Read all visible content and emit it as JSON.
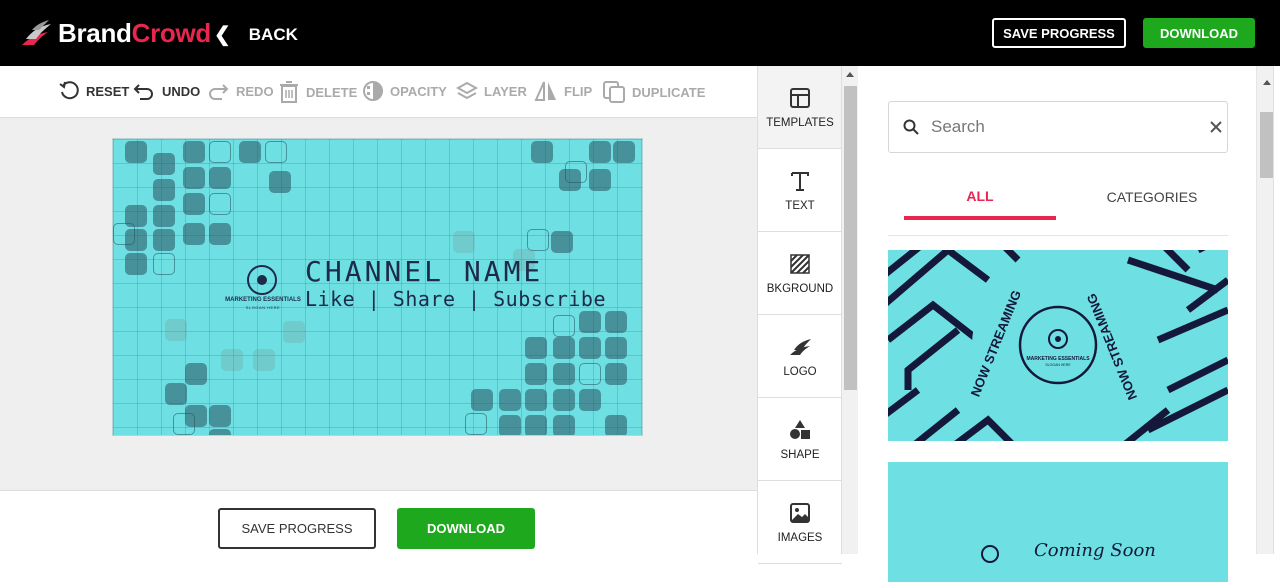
{
  "header": {
    "brand_left": "Brand",
    "brand_right": "Crowd",
    "back_label": "BACK",
    "save_label": "SAVE PROGRESS",
    "download_label": "DOWNLOAD"
  },
  "toolbar": {
    "reset": "RESET",
    "undo": "UNDO",
    "redo": "REDO",
    "delete": "DELETE",
    "opacity": "OPACITY",
    "layer": "LAYER",
    "flip": "FLIP",
    "duplicate": "DUPLICATE"
  },
  "canvas": {
    "channel_name": "CHANNEL NAME",
    "tagline": "Like | Share | Subscribe",
    "badge_title": "MARKETING ESSENTIALS",
    "badge_slogan": "SLOGAN HERE",
    "background_color": "#6ee0e3"
  },
  "bottom": {
    "save_label": "SAVE PROGRESS",
    "download_label": "DOWNLOAD"
  },
  "side_tabs": [
    {
      "label": "TEMPLATES",
      "icon": "templates-icon"
    },
    {
      "label": "TEXT",
      "icon": "text-icon"
    },
    {
      "label": "BKGROUND",
      "icon": "background-icon"
    },
    {
      "label": "LOGO",
      "icon": "logo-icon"
    },
    {
      "label": "SHAPE",
      "icon": "shape-icon"
    },
    {
      "label": "IMAGES",
      "icon": "images-icon"
    }
  ],
  "panel": {
    "search_placeholder": "Search",
    "tab_all": "ALL",
    "tab_categories": "CATEGORIES",
    "template1": {
      "ring_text": "NOW STREAMING",
      "badge_title": "MARKETING ESSENTIALS",
      "badge_slogan": "SLOGAN HERE"
    },
    "template2": {
      "partial_text": "Coming Soon"
    }
  },
  "colors": {
    "accent": "#e8264e",
    "download": "#1ea81e",
    "canvas_bg": "#6ee0e3",
    "navy": "#1d2a4a"
  }
}
